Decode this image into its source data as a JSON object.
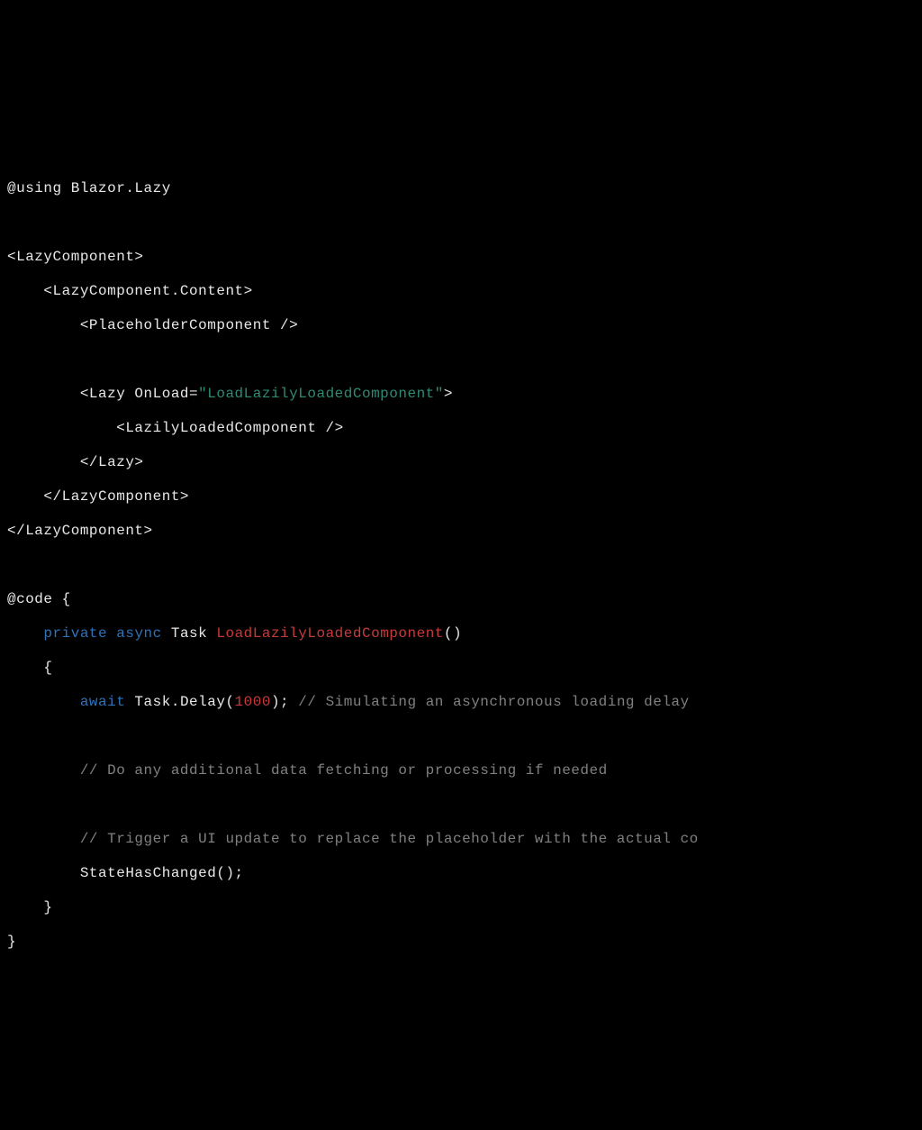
{
  "tokens": {
    "t01": "@using Blazor.Lazy",
    "t02": "<LazyComponent>",
    "t03": "    <LazyComponent.Content>",
    "t04": "        <PlaceholderComponent />",
    "t05a": "        <Lazy OnLoad=",
    "t05b": "\"LoadLazilyLoadedComponent\"",
    "t05c": ">",
    "t06": "            <LazilyLoadedComponent />",
    "t07": "        </Lazy>",
    "t08": "    </LazyComponent>",
    "t09": "</LazyComponent>",
    "t10": "@code {",
    "t11a": "    ",
    "t11b": "private",
    "t11c": " ",
    "t11d": "async",
    "t11e": " Task ",
    "t11f": "LoadLazilyLoadedComponent",
    "t11g": "()",
    "t12": "    {",
    "t13a": "        ",
    "t13b": "await",
    "t13c": " Task.Delay(",
    "t13d": "1000",
    "t13e": "); ",
    "t13f": "// Simulating an asynchronous loading delay",
    "t14a": "        ",
    "t14b": "// Do any additional data fetching or processing if needed",
    "t15a": "        ",
    "t15b": "// Trigger a UI update to replace the placeholder with the actual co",
    "t16": "        StateHasChanged();",
    "t17": "    }",
    "t18": "}"
  }
}
